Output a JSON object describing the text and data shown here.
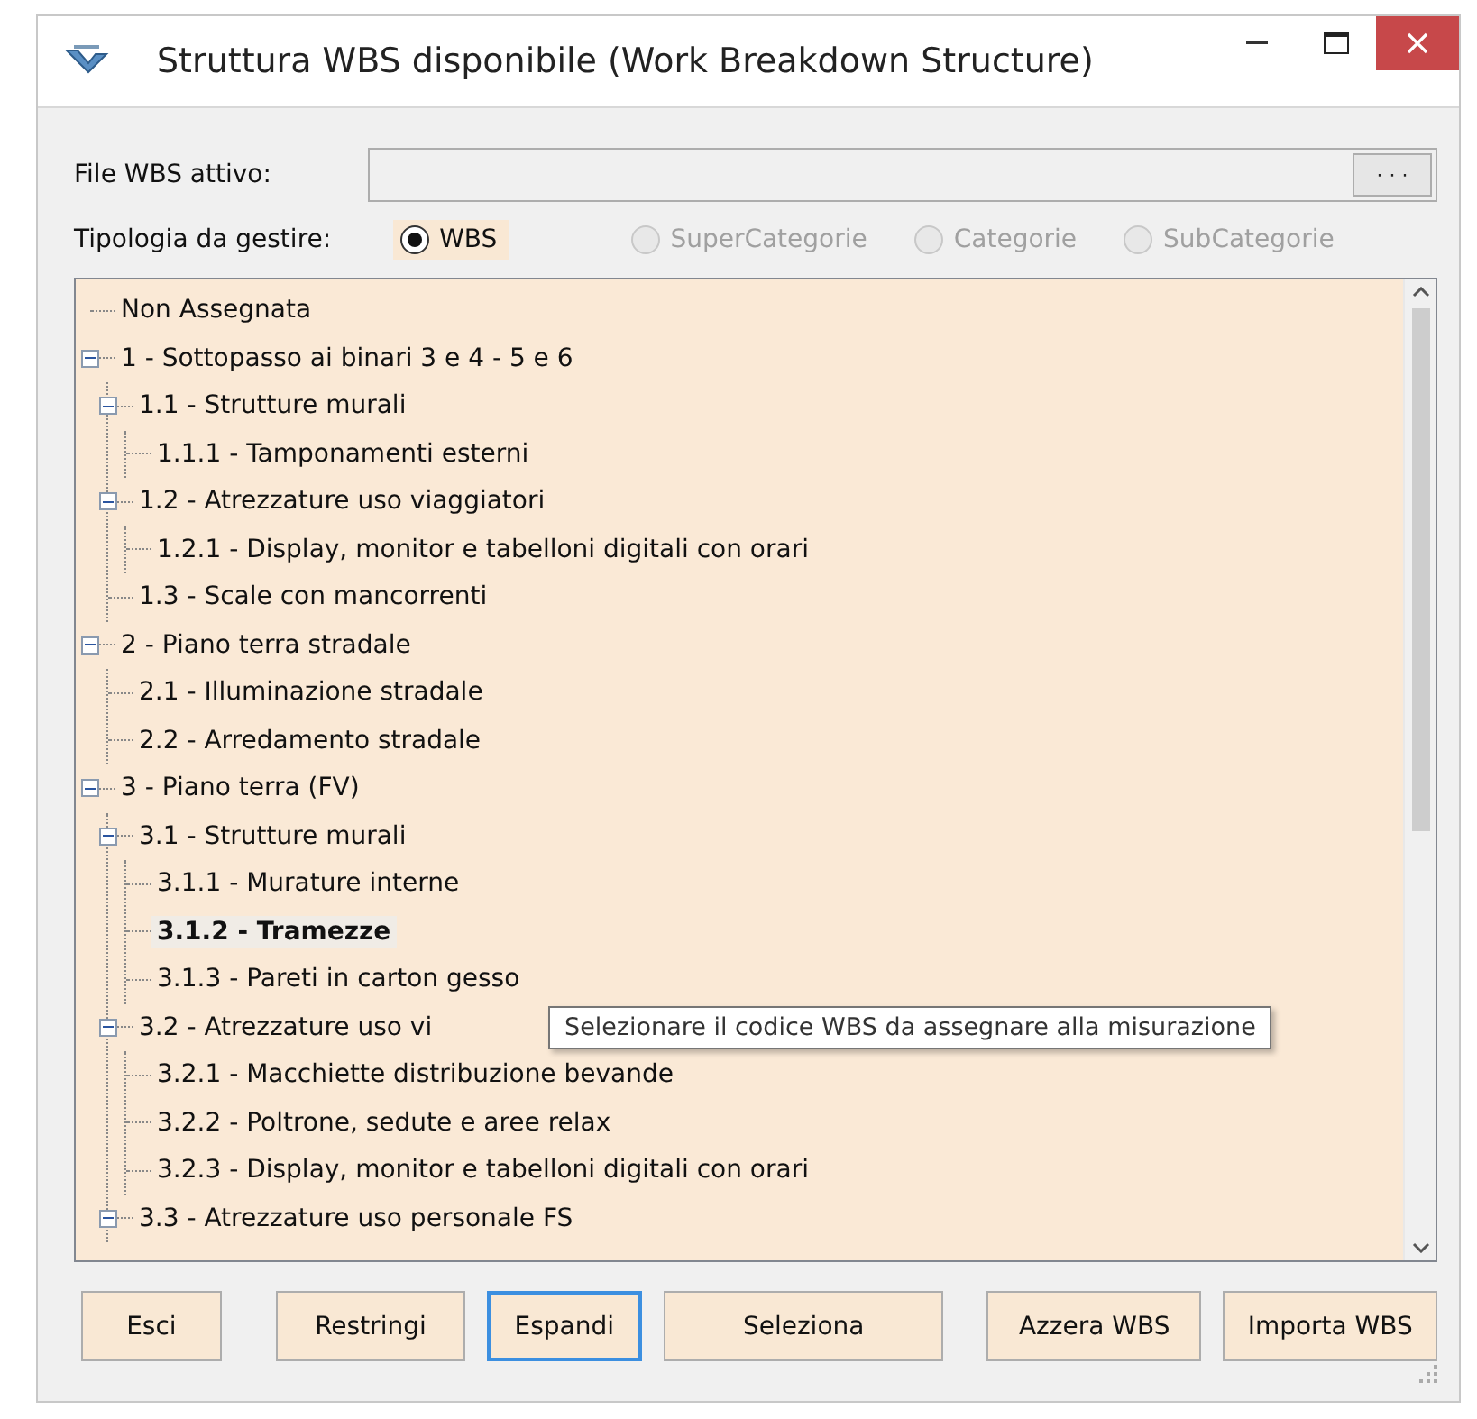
{
  "window": {
    "title": "Struttura WBS disponibile (Work Breakdown Structure)"
  },
  "file_field": {
    "label": "File WBS attivo:",
    "browse_button": "· · ·"
  },
  "type_group": {
    "label": "Tipologia da gestire:",
    "options": [
      {
        "label": "WBS",
        "selected": true,
        "disabled": false
      },
      {
        "label": "SuperCategorie",
        "selected": false,
        "disabled": true
      },
      {
        "label": "Categorie",
        "selected": false,
        "disabled": true
      },
      {
        "label": "SubCategorie",
        "selected": false,
        "disabled": true
      }
    ]
  },
  "tree": {
    "items": [
      {
        "label": "Non Assegnata",
        "selected": false
      },
      {
        "label": "1 - Sottopasso ai binari 3 e 4 -  5 e 6",
        "selected": false,
        "expanded": true,
        "children": [
          {
            "label": "1.1 - Strutture murali",
            "selected": false,
            "expanded": true,
            "children": [
              {
                "label": "1.1.1 - Tamponamenti esterni",
                "selected": false
              }
            ]
          },
          {
            "label": "1.2 - Atrezzature uso viaggiatori",
            "selected": false,
            "expanded": true,
            "children": [
              {
                "label": "1.2.1 - Display, monitor e tabelloni digitali con orari",
                "selected": false
              }
            ]
          },
          {
            "label": "1.3 - Scale con mancorrenti",
            "selected": false
          }
        ]
      },
      {
        "label": "2 - Piano terra stradale",
        "selected": false,
        "expanded": true,
        "children": [
          {
            "label": "2.1 - Illuminazione stradale",
            "selected": false
          },
          {
            "label": "2.2 - Arredamento stradale",
            "selected": false
          }
        ]
      },
      {
        "label": "3 - Piano terra (FV)",
        "selected": false,
        "expanded": true,
        "children": [
          {
            "label": "3.1 - Strutture murali",
            "selected": false,
            "expanded": true,
            "children": [
              {
                "label": "3.1.1 - Murature interne",
                "selected": false
              },
              {
                "label": "3.1.2 - Tramezze",
                "selected": true
              },
              {
                "label": "3.1.3 - Pareti in carton gesso",
                "selected": false
              }
            ]
          },
          {
            "label": "3.2 - Atrezzature uso vi",
            "selected": false,
            "expanded": true,
            "children": [
              {
                "label": "3.2.1 - Macchiette distribuzione bevande",
                "selected": false
              },
              {
                "label": "3.2.2 - Poltrone, sedute e aree relax",
                "selected": false
              },
              {
                "label": "3.2.3 - Display, monitor e tabelloni digitali con orari",
                "selected": false
              }
            ]
          },
          {
            "label": "3.3 - Atrezzature uso personale FS",
            "selected": false,
            "expanded": true
          }
        ]
      }
    ]
  },
  "tooltip": "Selezionare il codice WBS da assegnare alla misurazione",
  "buttons": [
    {
      "label": "Esci",
      "focused": false
    },
    {
      "label": "Restringi",
      "focused": false
    },
    {
      "label": "Espandi",
      "focused": true
    },
    {
      "label": "Seleziona",
      "focused": false
    },
    {
      "label": "Azzera WBS",
      "focused": false
    },
    {
      "label": "Importa WBS",
      "focused": false
    }
  ]
}
